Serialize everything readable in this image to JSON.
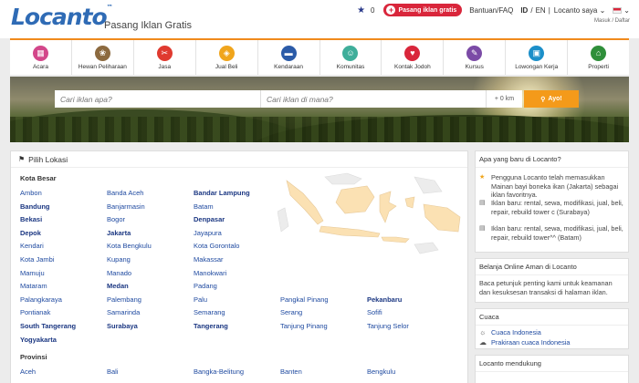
{
  "header": {
    "logo": "Locanto",
    "tagline": "Pasang Iklan Gratis",
    "favorites_count": "0",
    "post_ad": "Pasang iklan gratis",
    "help": "Bantuan/FAQ",
    "lang_id": "ID",
    "lang_sep": "/",
    "lang_en": "EN",
    "account": "Locanto saya",
    "login": "Masuk / Daftar"
  },
  "categories": [
    {
      "label": "Acara",
      "color": "#d3478a",
      "icon": "calendar-icon",
      "glyph": "▦"
    },
    {
      "label": "Hewan Peliharaan",
      "color": "#8c6a3f",
      "icon": "paw-icon",
      "glyph": "❀"
    },
    {
      "label": "Jasa",
      "color": "#e03a2f",
      "icon": "tools-icon",
      "glyph": "✂"
    },
    {
      "label": "Jual Beli",
      "color": "#f0a51c",
      "icon": "tag-icon",
      "glyph": "◈"
    },
    {
      "label": "Kendaraan",
      "color": "#2b5ba8",
      "icon": "car-icon",
      "glyph": "▬"
    },
    {
      "label": "Komunitas",
      "color": "#3fae9a",
      "icon": "people-icon",
      "glyph": "☺"
    },
    {
      "label": "Kontak Jodoh",
      "color": "#d9263b",
      "icon": "heart-icon",
      "glyph": "♥"
    },
    {
      "label": "Kursus",
      "color": "#7b4ba6",
      "icon": "pen-icon",
      "glyph": "✎"
    },
    {
      "label": "Lowongan Kerja",
      "color": "#1c8fc9",
      "icon": "briefcase-icon",
      "glyph": "▣"
    },
    {
      "label": "Properti",
      "color": "#2f8f3a",
      "icon": "house-icon",
      "glyph": "⌂"
    }
  ],
  "search": {
    "what_placeholder": "Cari iklan apa?",
    "where_placeholder": "Cari iklan di mana?",
    "radius": "+ 0 km",
    "button": "Ayo!"
  },
  "location": {
    "panel_title": "Pilih Lokasi",
    "big_cities_title": "Kota Besar",
    "cities": [
      {
        "name": "Ambon",
        "bold": false
      },
      {
        "name": "Banda Aceh",
        "bold": false
      },
      {
        "name": "Bandar Lampung",
        "bold": true
      },
      {
        "name": "",
        "bold": false
      },
      {
        "name": "",
        "bold": false
      },
      {
        "name": "Bandung",
        "bold": true
      },
      {
        "name": "Banjarmasin",
        "bold": false
      },
      {
        "name": "Batam",
        "bold": false
      },
      {
        "name": "",
        "bold": false
      },
      {
        "name": "",
        "bold": false
      },
      {
        "name": "Bekasi",
        "bold": true
      },
      {
        "name": "Bogor",
        "bold": false
      },
      {
        "name": "Denpasar",
        "bold": true
      },
      {
        "name": "",
        "bold": false
      },
      {
        "name": "",
        "bold": false
      },
      {
        "name": "Depok",
        "bold": true
      },
      {
        "name": "Jakarta",
        "bold": true
      },
      {
        "name": "Jayapura",
        "bold": false
      },
      {
        "name": "",
        "bold": false
      },
      {
        "name": "",
        "bold": false
      },
      {
        "name": "Kendari",
        "bold": false
      },
      {
        "name": "Kota Bengkulu",
        "bold": false
      },
      {
        "name": "Kota Gorontalo",
        "bold": false
      },
      {
        "name": "",
        "bold": false
      },
      {
        "name": "",
        "bold": false
      },
      {
        "name": "Kota Jambi",
        "bold": false
      },
      {
        "name": "Kupang",
        "bold": false
      },
      {
        "name": "Makassar",
        "bold": false
      },
      {
        "name": "",
        "bold": false
      },
      {
        "name": "",
        "bold": false
      },
      {
        "name": "Mamuju",
        "bold": false
      },
      {
        "name": "Manado",
        "bold": false
      },
      {
        "name": "Manokwari",
        "bold": false
      },
      {
        "name": "",
        "bold": false
      },
      {
        "name": "",
        "bold": false
      },
      {
        "name": "Mataram",
        "bold": false
      },
      {
        "name": "Medan",
        "bold": true
      },
      {
        "name": "Padang",
        "bold": false
      },
      {
        "name": "",
        "bold": false
      },
      {
        "name": "",
        "bold": false
      },
      {
        "name": "Palangkaraya",
        "bold": false
      },
      {
        "name": "Palembang",
        "bold": false
      },
      {
        "name": "Palu",
        "bold": false
      },
      {
        "name": "Pangkal Pinang",
        "bold": false
      },
      {
        "name": "Pekanbaru",
        "bold": true
      },
      {
        "name": "Pontianak",
        "bold": false
      },
      {
        "name": "Samarinda",
        "bold": false
      },
      {
        "name": "Semarang",
        "bold": false
      },
      {
        "name": "Serang",
        "bold": false
      },
      {
        "name": "Sofifi",
        "bold": false
      },
      {
        "name": "South Tangerang",
        "bold": true
      },
      {
        "name": "Surabaya",
        "bold": true
      },
      {
        "name": "Tangerang",
        "bold": true
      },
      {
        "name": "Tanjung Pinang",
        "bold": false
      },
      {
        "name": "Tanjung Selor",
        "bold": false
      },
      {
        "name": "Yogyakarta",
        "bold": true
      },
      {
        "name": "",
        "bold": false
      },
      {
        "name": "",
        "bold": false
      },
      {
        "name": "",
        "bold": false
      },
      {
        "name": "",
        "bold": false
      }
    ],
    "provinces_title": "Provinsi",
    "provinces": [
      "Aceh",
      "Bali",
      "Bangka-Belitung",
      "Banten",
      "Bengkulu"
    ]
  },
  "sidebar": {
    "whats_new_title": "Apa yang baru di Locanto?",
    "news": [
      {
        "icon": "star-icon",
        "text": "Pengguna Locanto telah memasukkan Mainan bayi boneka ikan (Jakarta) sebagai iklan favoritnya."
      },
      {
        "icon": "document-icon",
        "text": "Iklan baru: rental, sewa, modifikasi, jual, beli, repair, rebuild tower c (Surabaya)"
      },
      {
        "icon": "document-icon",
        "text": "Iklan baru: rental, sewa, modifikasi, jual, beli, repair, rebuild tower^^ (Batam)"
      }
    ],
    "safe_title": "Belanja Online Aman di Locanto",
    "safe_text": "Baca petunjuk penting kami untuk keamanan dan kesuksesan transaksi di halaman iklan.",
    "weather_title": "Cuaca",
    "weather_links": [
      "Cuaca Indonesia",
      "Prakiraan cuaca Indonesia"
    ],
    "support_title": "Locanto mendukung"
  }
}
